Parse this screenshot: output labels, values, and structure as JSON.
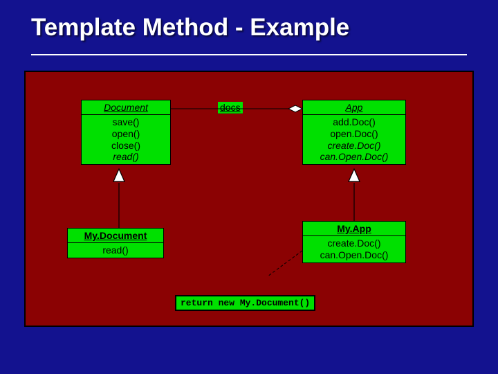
{
  "title": "Template Method - Example",
  "diagram": {
    "assoc_label": "docs",
    "document": {
      "name": "Document",
      "methods": [
        "save()",
        "open()",
        "close()",
        "read()"
      ],
      "abstract_indices": [
        3
      ]
    },
    "app": {
      "name": "App",
      "methods": [
        "add.Doc()",
        "open.Doc()",
        "create.Doc()",
        "can.Open.Doc()"
      ],
      "abstract_indices": [
        2,
        3
      ]
    },
    "mydocument": {
      "name": "My.Document",
      "methods": [
        "read()"
      ]
    },
    "myapp": {
      "name": "My.App",
      "methods": [
        "create.Doc()",
        "can.Open.Doc()"
      ]
    },
    "note": "return new My.Document()"
  }
}
